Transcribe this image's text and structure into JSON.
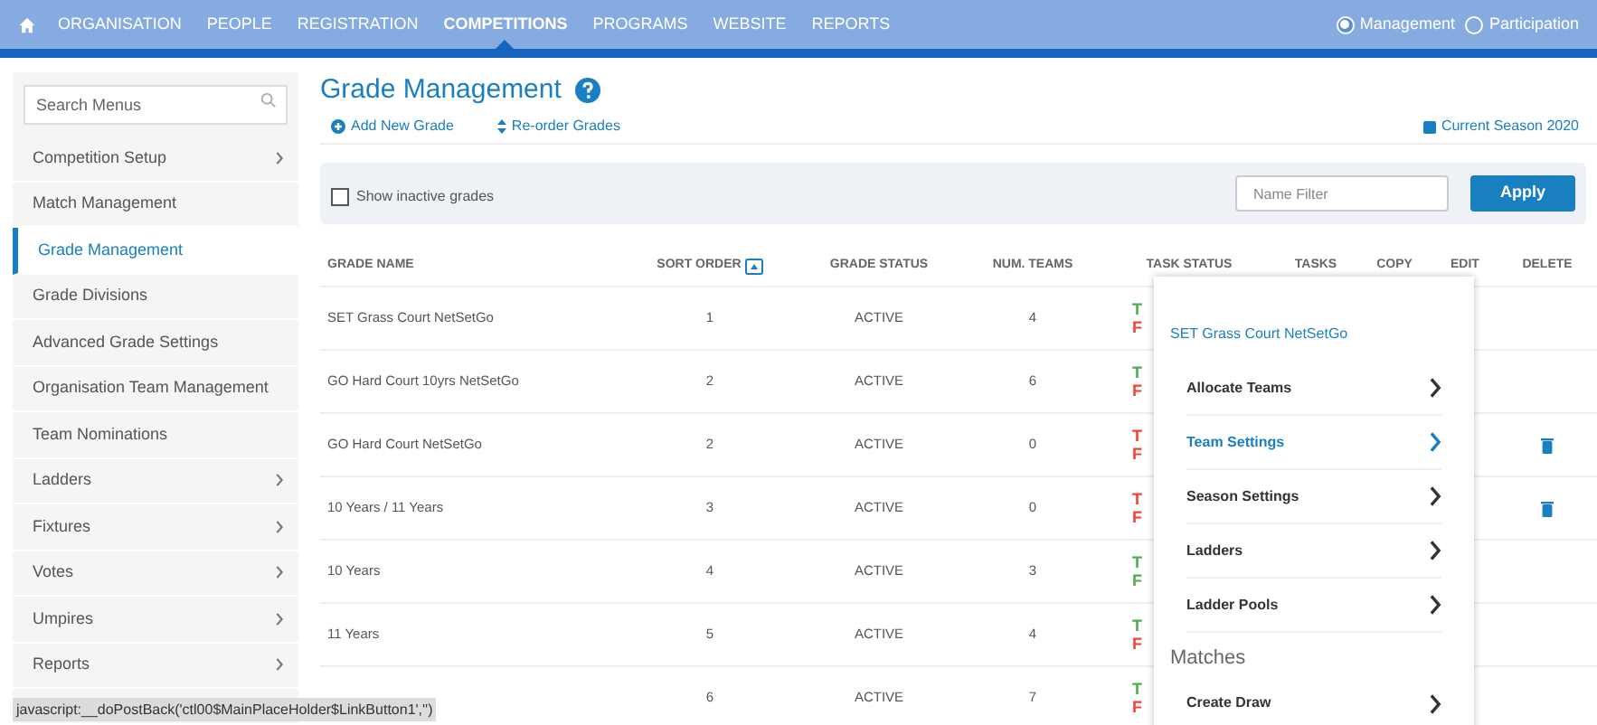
{
  "nav": {
    "items": [
      {
        "label": "ORGANISATION",
        "selected": false
      },
      {
        "label": "PEOPLE",
        "selected": false
      },
      {
        "label": "REGISTRATION",
        "selected": false
      },
      {
        "label": "COMPETITIONS",
        "selected": true
      },
      {
        "label": "PROGRAMS",
        "selected": false
      },
      {
        "label": "WEBSITE",
        "selected": false
      },
      {
        "label": "REPORTS",
        "selected": false
      }
    ],
    "modes": [
      {
        "label": "Management",
        "selected": true
      },
      {
        "label": "Participation",
        "selected": false
      }
    ]
  },
  "sidebar": {
    "search": {
      "placeholder": "Search Menus"
    },
    "items": [
      {
        "label": "Competition Setup",
        "has_submenu": true,
        "selected": false
      },
      {
        "label": "Match Management",
        "has_submenu": false,
        "selected": false
      },
      {
        "label": "Grade Management",
        "has_submenu": false,
        "selected": true
      },
      {
        "label": "Grade Divisions",
        "has_submenu": false,
        "selected": false
      },
      {
        "label": "Advanced Grade Settings",
        "has_submenu": false,
        "selected": false
      },
      {
        "label": "Organisation Team Management",
        "has_submenu": false,
        "selected": false
      },
      {
        "label": "Team Nominations",
        "has_submenu": false,
        "selected": false
      },
      {
        "label": "Ladders",
        "has_submenu": true,
        "selected": false
      },
      {
        "label": "Fixtures",
        "has_submenu": true,
        "selected": false
      },
      {
        "label": "Votes",
        "has_submenu": true,
        "selected": false
      },
      {
        "label": "Umpires",
        "has_submenu": true,
        "selected": false
      },
      {
        "label": "Reports",
        "has_submenu": true,
        "selected": false
      }
    ]
  },
  "page": {
    "title": "Grade Management",
    "actions": [
      "Add New Grade",
      "Re-order Grades"
    ],
    "season": "Current Season 2020"
  },
  "filter": {
    "checkbox": {
      "label": "Show inactive grades",
      "checked": false
    },
    "name_filter": {
      "placeholder": "Name Filter"
    },
    "button": "Apply"
  },
  "table": {
    "columns": [
      "GRADE NAME",
      "SORT ORDER",
      "GRADE STATUS",
      "NUM. TEAMS",
      "TASK STATUS",
      "TASKS",
      "COPY",
      "EDIT",
      "DELETE"
    ],
    "rows": [
      {
        "name": "SET Grass Court NetSetGo",
        "sort": "1",
        "status": "ACTIVE",
        "teams": "4",
        "task_status": [
          {
            "text": "T",
            "color": "#4caf50"
          },
          {
            "text": "F",
            "color": "#f44336"
          }
        ],
        "deletable": false
      },
      {
        "name": "GO Hard Court 10yrs NetSetGo",
        "sort": "2",
        "status": "ACTIVE",
        "teams": "6",
        "task_status": [
          {
            "text": "T",
            "color": "#4caf50"
          },
          {
            "text": "F",
            "color": "#f44336"
          }
        ],
        "deletable": false
      },
      {
        "name": "GO Hard Court NetSetGo",
        "sort": "2",
        "status": "ACTIVE",
        "teams": "0",
        "task_status": [
          {
            "text": "T",
            "color": "#f44336"
          },
          {
            "text": "F",
            "color": "#f44336"
          }
        ],
        "deletable": true
      },
      {
        "name": "10 Years / 11 Years",
        "sort": "3",
        "status": "ACTIVE",
        "teams": "0",
        "task_status": [
          {
            "text": "T",
            "color": "#f44336"
          },
          {
            "text": "F",
            "color": "#f44336"
          }
        ],
        "deletable": true
      },
      {
        "name": "10 Years",
        "sort": "4",
        "status": "ACTIVE",
        "teams": "3",
        "task_status": [
          {
            "text": "T",
            "color": "#4caf50"
          },
          {
            "text": "F",
            "color": "#4caf50"
          }
        ],
        "deletable": false
      },
      {
        "name": "11 Years",
        "sort": "5",
        "status": "ACTIVE",
        "teams": "4",
        "task_status": [
          {
            "text": "T",
            "color": "#4caf50"
          },
          {
            "text": "F",
            "color": "#f44336"
          }
        ],
        "deletable": false
      },
      {
        "sort": "6",
        "status": "ACTIVE",
        "teams": "7",
        "task_status": [
          {
            "text": "T",
            "color": "#4caf50"
          },
          {
            "text": "F",
            "color": "#f44336"
          }
        ],
        "deletable": false
      }
    ]
  },
  "popup": {
    "title": "SET Grass Court NetSetGo",
    "sections": [
      {
        "items": [
          {
            "label": "Allocate Teams",
            "selected": false
          },
          {
            "label": "Team Settings",
            "selected": true
          },
          {
            "label": "Season Settings",
            "selected": false
          },
          {
            "label": "Ladders",
            "selected": false
          },
          {
            "label": "Ladder Pools",
            "selected": false
          }
        ]
      },
      {
        "heading": "Matches",
        "items": [
          {
            "label": "Create Draw",
            "selected": false
          }
        ]
      }
    ]
  },
  "status_bar": "javascript:__doPostBack('ctl00$MainPlaceHolder$LinkButton1','')"
}
